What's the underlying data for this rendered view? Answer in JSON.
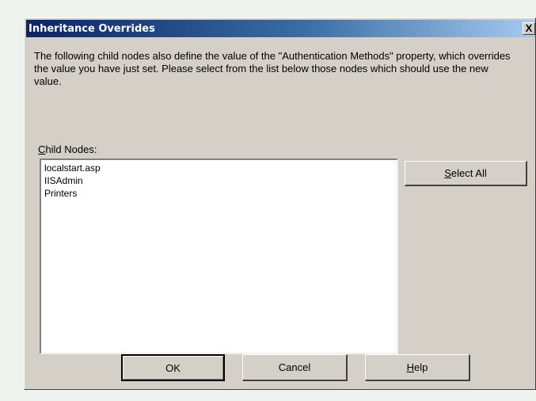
{
  "window": {
    "title": "Inheritance Overrides",
    "close_label": "X"
  },
  "description": "The following child nodes also define the value of the \"Authentication Methods\" property, which overrides the value you have just set. Please select from the list below those nodes which should use the new value.",
  "child_nodes": {
    "label_accel": "C",
    "label_rest": "hild Nodes:",
    "items": [
      "localstart.asp",
      "IISAdmin",
      "Printers"
    ]
  },
  "buttons": {
    "select_all_accel": "S",
    "select_all_rest": "elect All",
    "ok": "OK",
    "cancel": "Cancel",
    "help_accel": "H",
    "help_rest": "elp"
  }
}
